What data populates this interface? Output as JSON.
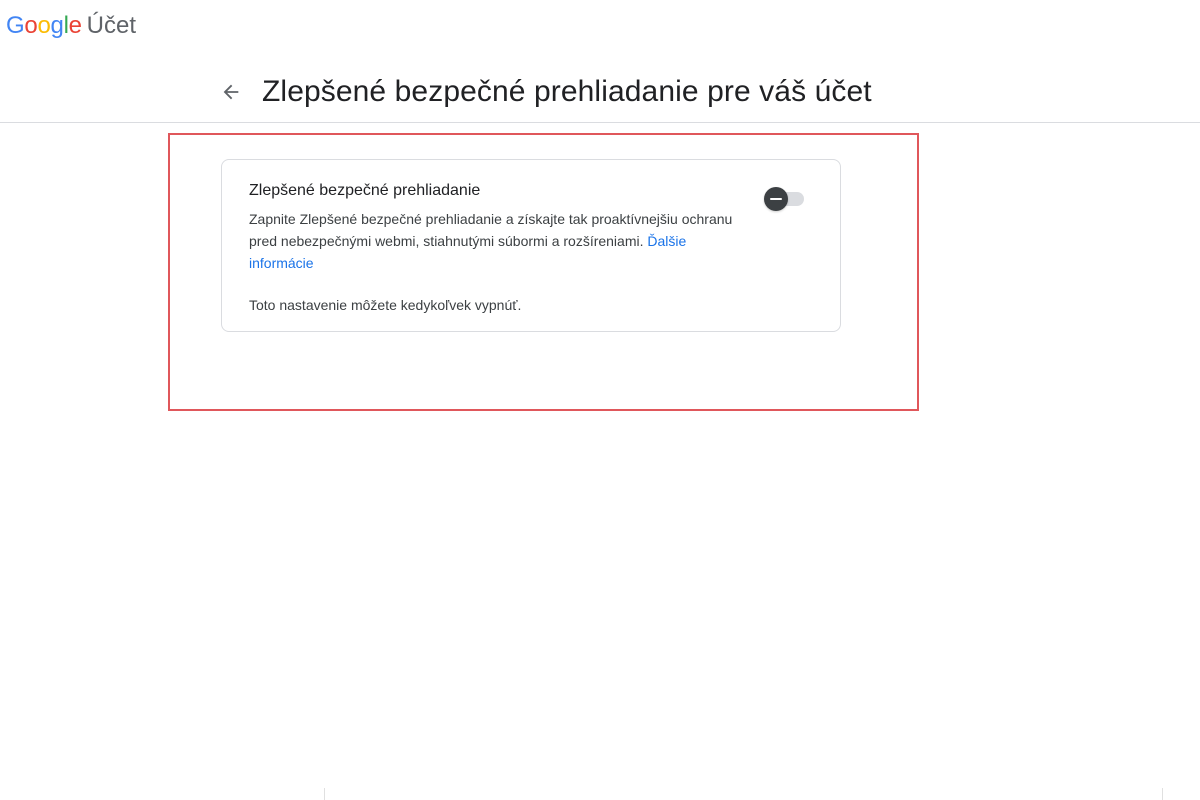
{
  "header": {
    "logo": {
      "letters": [
        "G",
        "o",
        "o",
        "g",
        "l",
        "e"
      ],
      "letter_colors": [
        "#4285F4",
        "#EA4335",
        "#FBBC05",
        "#4285F4",
        "#34A853",
        "#EA4335"
      ],
      "product": "Účet"
    },
    "page_title": "Zlepšené bezpečné prehliadanie pre váš účet",
    "back_icon": "arrow-left-icon"
  },
  "card": {
    "title": "Zlepšené bezpečné prehliadanie",
    "description": "Zapnite Zlepšené bezpečné prehliadanie a získajte tak proaktívnejšiu ochranu pred nebezpečnými webmi, stiahnutými súbormi a rozšíreniami.",
    "link_label": "Ďalšie informácie",
    "note": "Toto nastavenie môžete kedykoľvek vypnúť.",
    "toggle": {
      "state": "off",
      "icon": "toggle-off-icon"
    }
  },
  "colors": {
    "highlight_border": "#e0575b",
    "link": "#1a73e8",
    "divider": "#dadce0"
  }
}
